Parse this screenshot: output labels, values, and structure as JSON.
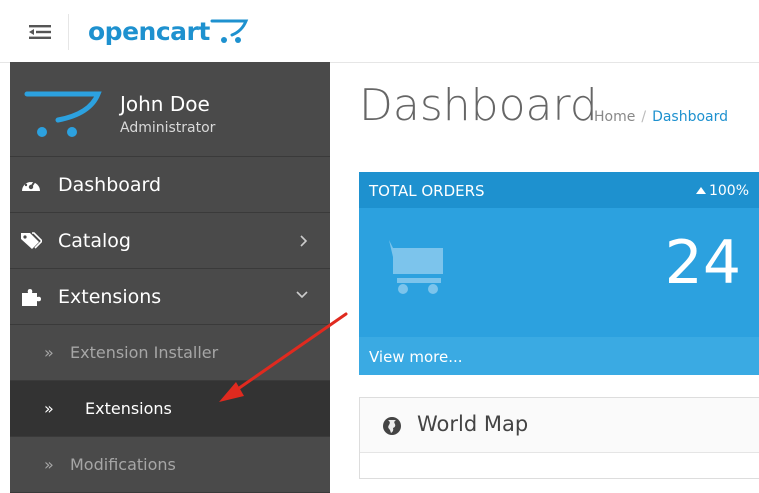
{
  "header": {
    "logo_text": "opencart",
    "menu_icon": "menu-toggle-icon"
  },
  "sidebar": {
    "user_name": "John Doe",
    "user_role": "Administrator",
    "items": [
      {
        "label": "Dashboard",
        "icon": "dashboard-icon"
      },
      {
        "label": "Catalog",
        "icon": "tags-icon"
      },
      {
        "label": "Extensions",
        "icon": "puzzle-icon"
      }
    ],
    "extension_subitems": [
      {
        "label": "Extension Installer"
      },
      {
        "label": "Extensions",
        "active": true
      },
      {
        "label": "Modifications"
      }
    ],
    "subitem_marker": "»"
  },
  "page": {
    "title": "Dashboard",
    "breadcrumb": [
      {
        "label": "Home"
      },
      {
        "label": "Dashboard"
      }
    ],
    "breadcrumb_separator": "/"
  },
  "orders_tile": {
    "title": "TOTAL ORDERS",
    "change": "100%",
    "value": "24",
    "link": "View more..."
  },
  "world_map": {
    "title": "World Map"
  },
  "colors": {
    "brand": "#1e91cf",
    "tile": "#2ca1df",
    "sidebar": "#4a4a4a",
    "sidebar_active": "#333333",
    "annotation_arrow": "#e02a1f"
  }
}
